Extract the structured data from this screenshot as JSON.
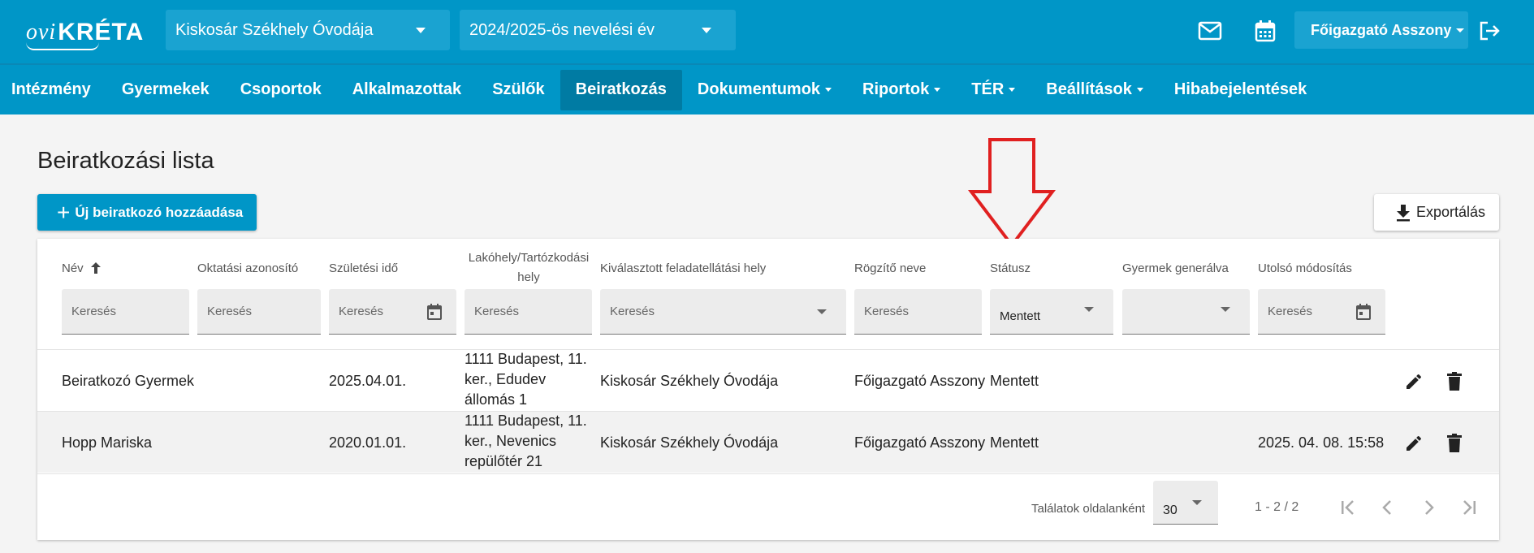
{
  "header": {
    "logo_ovi": "ovi",
    "logo_kreta": "KRÉTA",
    "institution": "Kiskosár Székhely Óvodája",
    "school_year": "2024/2025-ös nevelési év",
    "user": "Főigazgató Asszony",
    "icons": [
      "mail-icon",
      "calendar-icon",
      "logout-icon"
    ]
  },
  "nav": {
    "items": [
      {
        "label": "Intézmény",
        "dropdown": false
      },
      {
        "label": "Gyermekek",
        "dropdown": false
      },
      {
        "label": "Csoportok",
        "dropdown": false
      },
      {
        "label": "Alkalmazottak",
        "dropdown": false
      },
      {
        "label": "Szülők",
        "dropdown": false
      },
      {
        "label": "Beiratkozás",
        "dropdown": false,
        "active": true
      },
      {
        "label": "Dokumentumok",
        "dropdown": true
      },
      {
        "label": "Riportok",
        "dropdown": true
      },
      {
        "label": "TÉR",
        "dropdown": true
      },
      {
        "label": "Beállítások",
        "dropdown": true
      },
      {
        "label": "Hibabejelentések",
        "dropdown": false
      }
    ]
  },
  "page": {
    "title": "Beiratkozási lista",
    "add_button": "Új beiratkozó hozzáadása",
    "export_button": "Exportálás"
  },
  "table": {
    "columns": {
      "name": "Név",
      "edu_id": "Oktatási azonosító",
      "birth": "Születési idő",
      "address_line1": "Lakóhely/Tartózkodási",
      "address_line2": "hely",
      "location": "Kiválasztott feladatellátási hely",
      "recorder": "Rögzítő neve",
      "status": "Státusz",
      "generated": "Gyermek generálva",
      "modified": "Utolsó módosítás"
    },
    "filters": {
      "placeholder": "Keresés",
      "status_value": "Mentett"
    },
    "rows": [
      {
        "name": "Beiratkozó Gyermek",
        "edu_id": "",
        "birth": "2025.04.01.",
        "address": [
          "1111 Budapest, 11.",
          "ker., Edudev",
          "állomás 1"
        ],
        "location": "Kiskosár Székhely Óvodája",
        "recorder": "Főigazgató Asszony",
        "status": "Mentett",
        "generated": "",
        "modified": ""
      },
      {
        "name": "Hopp Mariska",
        "edu_id": "",
        "birth": "2020.01.01.",
        "address": [
          "1111 Budapest, 11.",
          "ker., Nevenics",
          "repülőtér 21"
        ],
        "location": "Kiskosár Székhely Óvodája",
        "recorder": "Főigazgató Asszony",
        "status": "Mentett",
        "generated": "",
        "modified": "2025. 04. 08. 15:58"
      }
    ]
  },
  "pagination": {
    "per_page_label": "Találatok oldalanként",
    "per_page": "30",
    "range": "1 - 2 / 2"
  },
  "colors": {
    "primary": "#0096c7",
    "active_nav": "#007ba3",
    "annotation_arrow": "#e02020"
  }
}
